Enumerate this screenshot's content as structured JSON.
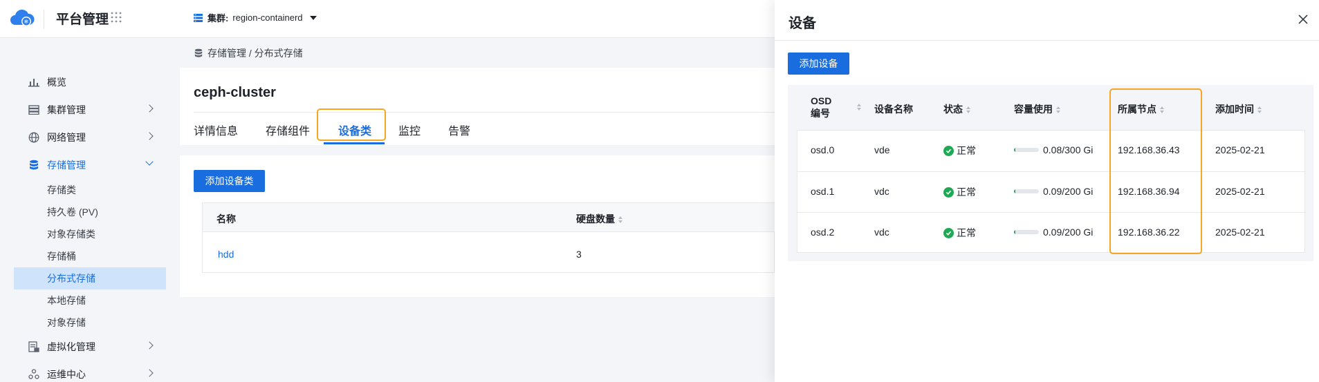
{
  "topbar": {
    "title": "平台管理",
    "cluster_label": "集群:",
    "cluster_value": "region-containerd"
  },
  "sidebar": {
    "items": [
      {
        "label": "概览"
      },
      {
        "label": "集群管理"
      },
      {
        "label": "网络管理"
      },
      {
        "label": "存储管理"
      },
      {
        "label": "虚拟化管理"
      },
      {
        "label": "运维中心"
      }
    ],
    "storage_sub": [
      {
        "label": "存储类"
      },
      {
        "label": "持久卷 (PV)"
      },
      {
        "label": "对象存储类"
      },
      {
        "label": "存储桶"
      },
      {
        "label": "分布式存储"
      },
      {
        "label": "本地存储"
      },
      {
        "label": "对象存储"
      }
    ]
  },
  "breadcrumb": "存储管理 / 分布式存储",
  "page": {
    "title": "ceph-cluster",
    "tabs": [
      {
        "label": "详情信息"
      },
      {
        "label": "存储组件"
      },
      {
        "label": "设备类"
      },
      {
        "label": "监控"
      },
      {
        "label": "告警"
      }
    ],
    "add_class_button": "添加设备类",
    "table": {
      "headers": [
        "名称",
        "硬盘数量"
      ],
      "rows": [
        {
          "name": "hdd",
          "disks": "3"
        }
      ]
    }
  },
  "drawer": {
    "title": "设备",
    "add_button": "添加设备",
    "headers": [
      "OSD 编号",
      "设备名称",
      "状态",
      "容量使用",
      "所属节点",
      "添加时间"
    ],
    "rows": [
      {
        "osd": "osd.0",
        "device": "vde",
        "status": "正常",
        "usage": "0.08/300 Gi",
        "usage_frac": 0.0003,
        "node": "192.168.36.43",
        "time": "2025-02-21"
      },
      {
        "osd": "osd.1",
        "device": "vdc",
        "status": "正常",
        "usage": "0.09/200 Gi",
        "usage_frac": 0.0005,
        "node": "192.168.36.94",
        "time": "2025-02-21"
      },
      {
        "osd": "osd.2",
        "device": "vdc",
        "status": "正常",
        "usage": "0.09/200 Gi",
        "usage_frac": 0.0005,
        "node": "192.168.36.22",
        "time": "2025-02-21"
      }
    ]
  },
  "colors": {
    "primary": "#1a6dde",
    "success": "#1fa855",
    "highlight": "#f5a623"
  }
}
